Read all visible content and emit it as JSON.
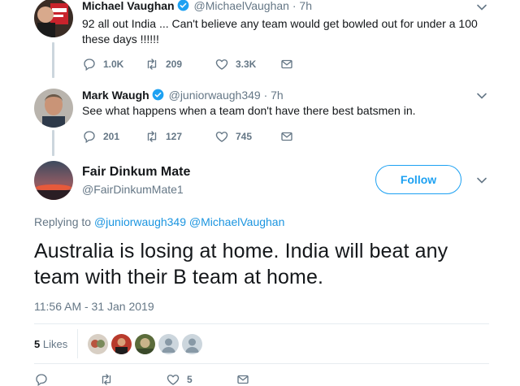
{
  "thread": [
    {
      "display_name": "Michael Vaughan",
      "handle": "@MichaelVaughan",
      "dot": "·",
      "time": "7h",
      "text": "92 all out India ... Can't believe any team would get bowled out for under a 100 these days !!!!!!",
      "replies": "1.0K",
      "retweets": "209",
      "likes": "3.3K",
      "verified": true
    },
    {
      "display_name": "Mark Waugh",
      "handle": "@juniorwaugh349",
      "dot": "·",
      "time": "7h",
      "text": "See what happens when a team don't have there best batsmen in.",
      "replies": "201",
      "retweets": "127",
      "likes": "745",
      "verified": true
    }
  ],
  "main_tweet": {
    "display_name": "Fair Dinkum Mate",
    "handle": "@FairDinkumMate1",
    "follow_label": "Follow",
    "replying_prefix": "Replying to",
    "reply_to_1": "@juniorwaugh349",
    "reply_to_2": "@MichaelVaughan",
    "text": "Australia is losing at home. India will beat any team with their B team at home.",
    "timestamp": "11:56 AM - 31 Jan 2019",
    "likes_count": "5",
    "likes_label": "Likes",
    "bottom_likes": "5"
  },
  "icons": [
    "reply-icon",
    "retweet-icon",
    "like-icon",
    "dm-icon",
    "verified-icon",
    "chevron-down-icon"
  ],
  "colors": {
    "accent": "#1da1f2",
    "muted": "#657786",
    "text": "#14171a",
    "thread_line": "#ccd6dd"
  }
}
